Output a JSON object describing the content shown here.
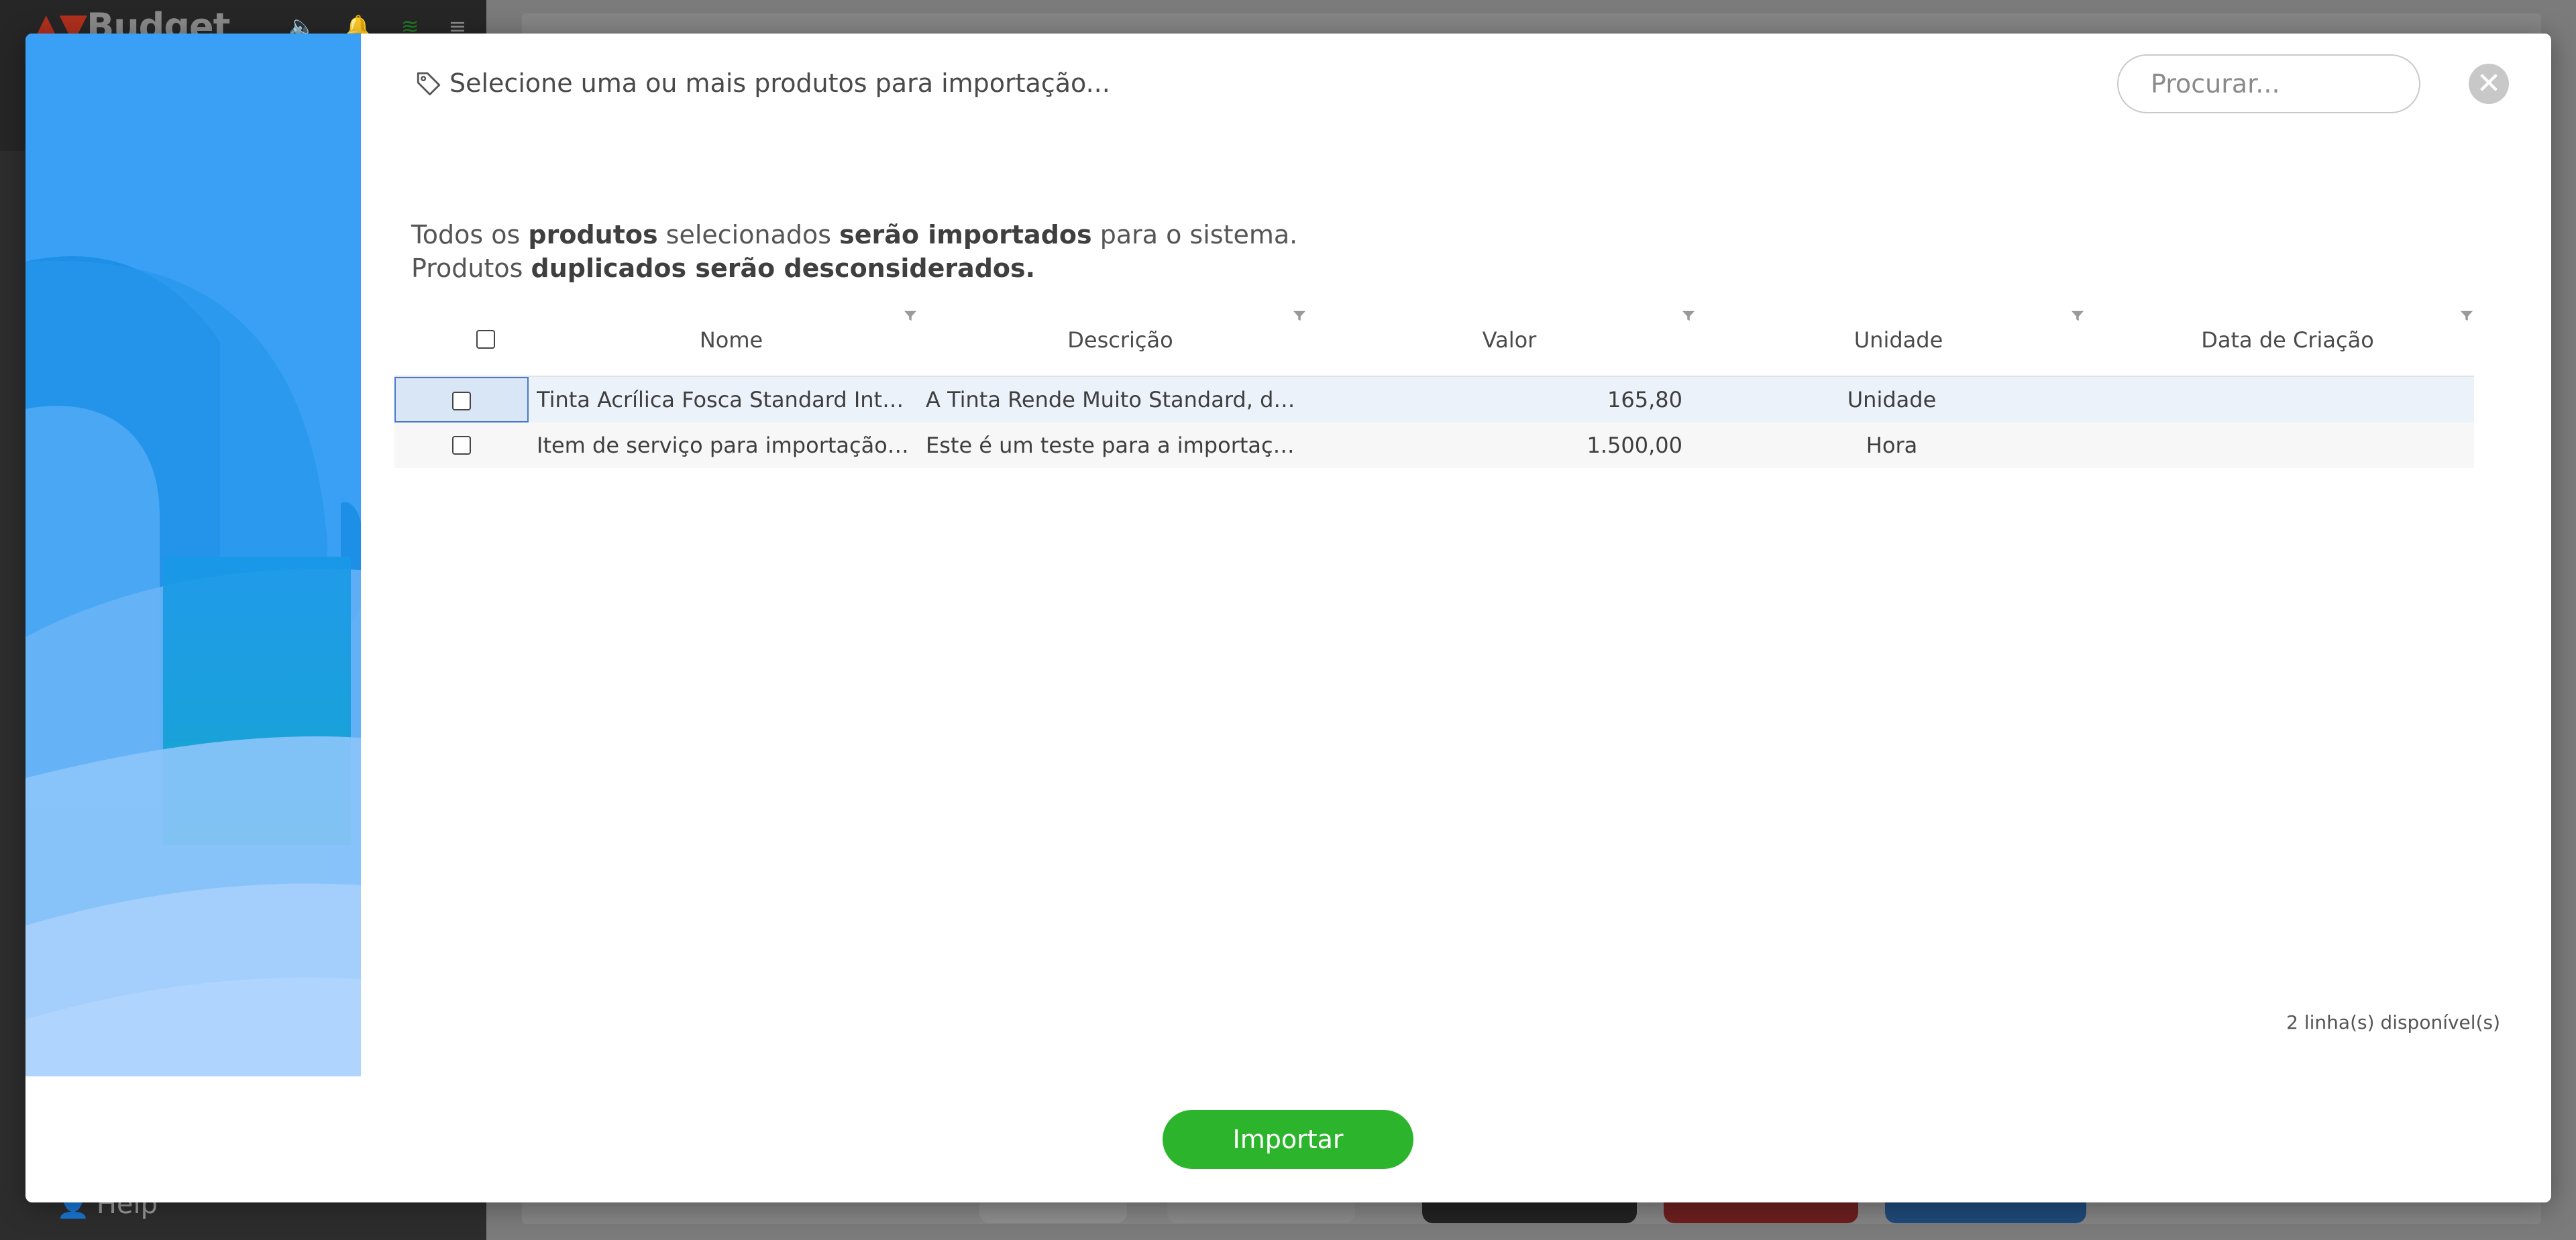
{
  "background": {
    "logo": "Budget",
    "help": "Help"
  },
  "modal": {
    "title": "Selecione uma ou mais produtos para importação...",
    "search_placeholder": "Procurar...",
    "close_symbol": "✕",
    "info": {
      "line1_parts": [
        "Todos os ",
        "produtos",
        " selecionados ",
        "serão importados",
        " para o sistema."
      ],
      "line2_parts": [
        "Produtos ",
        "duplicados serão desconsiderados."
      ]
    },
    "columns": [
      "Nome",
      "Descrição",
      "Valor",
      "Unidade",
      "Data de Criação"
    ],
    "rows": [
      {
        "nome": "Tinta Acrílica Fosca Standard Interior ...",
        "descricao": "A Tinta Rende Muito Standard, da Cor...",
        "valor": "165,80",
        "unidade": "Unidade",
        "data": ""
      },
      {
        "nome": "Item de serviço para importação WB...",
        "descricao": "Este é um teste para a importação de...",
        "valor": "1.500,00",
        "unidade": "Hora",
        "data": ""
      }
    ],
    "row_count": "2 linha(s) disponível(s)",
    "import_label": "Importar"
  },
  "colors": {
    "accent_green": "#2cb52c",
    "brand_blue": "#3aa0f5",
    "selection": "#4a78c8"
  },
  "icons": {
    "title": "tag-icon",
    "close": "close-icon",
    "filter": "filter-icon"
  }
}
